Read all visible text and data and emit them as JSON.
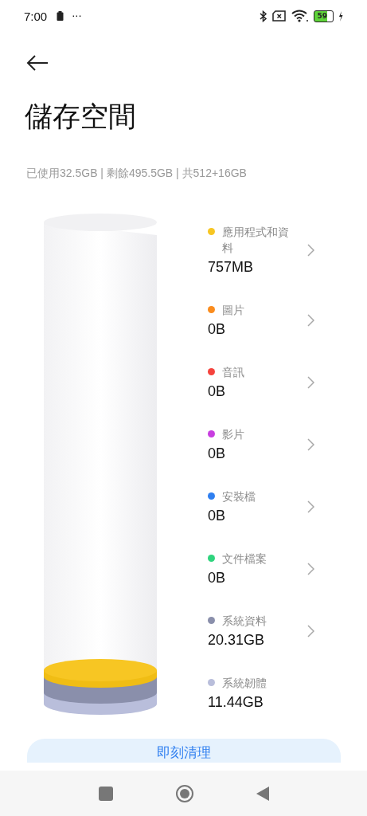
{
  "status_bar": {
    "time": "7:00",
    "more": "···",
    "battery": "59"
  },
  "title": "儲存空間",
  "summary": "已使用32.5GB | 剩餘495.5GB | 共512+16GB",
  "categories": [
    {
      "label": "應用程式和資料",
      "size": "757MB",
      "color": "#f7c623",
      "kind": "link"
    },
    {
      "label": "圖片",
      "size": "0B",
      "color": "#fa8c1e",
      "kind": "link"
    },
    {
      "label": "音訊",
      "size": "0B",
      "color": "#f5433d",
      "kind": "link"
    },
    {
      "label": "影片",
      "size": "0B",
      "color": "#c83ee0",
      "kind": "link"
    },
    {
      "label": "安裝檔",
      "size": "0B",
      "color": "#2f7ff0",
      "kind": "link"
    },
    {
      "label": "文件檔案",
      "size": "0B",
      "color": "#2fd47e",
      "kind": "link"
    },
    {
      "label": "系統資料",
      "size": "20.31GB",
      "color": "#8a8fab",
      "kind": "link"
    },
    {
      "label": "系統韌體",
      "size": "11.44GB",
      "color": "#b9bedb",
      "kind": "plain"
    }
  ],
  "clean_button": "即刻清理"
}
